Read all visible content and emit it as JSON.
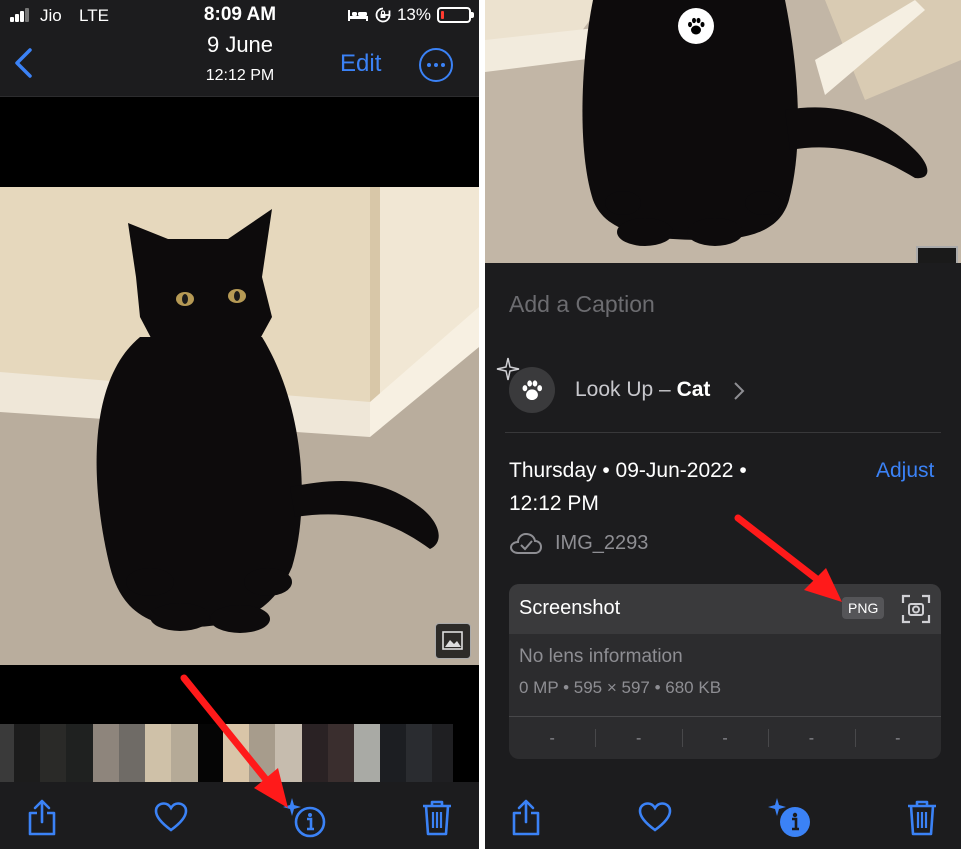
{
  "left": {
    "status_bar": {
      "carrier": "Jio",
      "network": "LTE",
      "time": "8:09 AM",
      "battery": "13%",
      "battery_level": 0.13,
      "icons": [
        "signal-icon",
        "bed-icon",
        "orientation-lock-icon",
        "battery-icon"
      ]
    },
    "nav": {
      "date": "9 June",
      "time": "12:12 PM",
      "edit_label": "Edit",
      "back_icon": "chevron-left-icon",
      "more_icon": "more-icon"
    },
    "toolbar": {
      "icons": [
        "share-icon",
        "heart-icon",
        "info-sparkle-icon",
        "trash-icon"
      ]
    }
  },
  "right": {
    "caption_placeholder": "Add a Caption",
    "lookup": {
      "prefix": "Look Up – ",
      "subject": "Cat"
    },
    "date_line1": "Thursday • 09-Jun-2022 •",
    "date_line2": "12:12 PM",
    "adjust_label": "Adjust",
    "filename": "IMG_2293",
    "metadata": {
      "title": "Screenshot",
      "format": "PNG",
      "lens_info": "No lens information",
      "specs": "0 MP • 595 × 597 • 680 KB",
      "exif": [
        "-",
        "-",
        "-",
        "-",
        "-"
      ]
    },
    "toolbar": {
      "icons": [
        "share-icon",
        "heart-icon",
        "info-filled-icon",
        "trash-icon"
      ]
    }
  },
  "colors": {
    "accent": "#3b82f6",
    "background": "#000000",
    "panel": "#1c1c1e",
    "annotation": "#ff1a1a",
    "battery_low": "#ff3b30"
  }
}
